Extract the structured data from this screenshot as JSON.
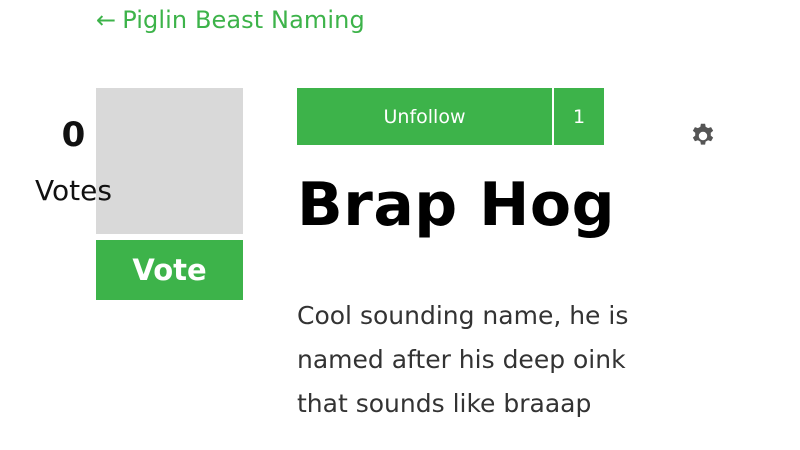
{
  "nav": {
    "back_arrow": "←",
    "back_label": "Piglin Beast Naming"
  },
  "votes": {
    "count": "0",
    "label": "Votes",
    "button_label": "Vote"
  },
  "follow": {
    "label": "Unfollow",
    "count": "1"
  },
  "settings": {
    "icon": "gear-icon"
  },
  "post": {
    "title": "Brap Hog",
    "description_lines": [
      "Cool sounding name, he is",
      "named after his deep oink",
      "that sounds like braaap"
    ]
  },
  "colors": {
    "accent": "#3db34a",
    "vote_box_bg": "#d9d9d9",
    "settings_icon": "#555555"
  }
}
